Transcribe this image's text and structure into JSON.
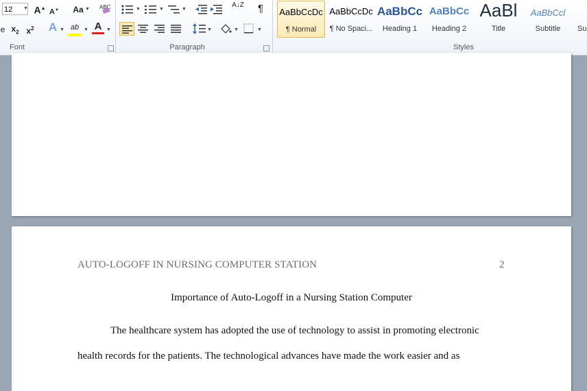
{
  "ribbon": {
    "font_size": "12",
    "groups": {
      "font": "Font",
      "paragraph": "Paragraph",
      "styles": "Styles"
    },
    "styles": [
      {
        "preview": "AaBbCcDc",
        "name": "¶ Normal"
      },
      {
        "preview": "AaBbCcDc",
        "name": "¶ No Spaci..."
      },
      {
        "preview": "AaBbCc",
        "name": "Heading 1"
      },
      {
        "preview": "AaBbCc",
        "name": "Heading 2"
      },
      {
        "preview": "AaBl",
        "name": "Title"
      },
      {
        "preview": "AaBbCcl",
        "name": "Subtitle"
      },
      {
        "preview": "",
        "name": "Su"
      }
    ],
    "buttons": {
      "grow": "A",
      "shrink": "A",
      "change_case": "Aa",
      "clear_format": "ABC",
      "subscript": "x",
      "superscript": "x",
      "text_effects": "A",
      "highlight": "ab",
      "font_color": "A",
      "sort": "A↓Z",
      "pilcrow": "¶"
    },
    "colors": {
      "highlight": "#ffff00",
      "font_color": "#e01f1f",
      "heading": "#2b579a"
    }
  },
  "document": {
    "header_text": "AUTO-LOGOFF IN NURSING COMPUTER STATION",
    "page_number": "2",
    "title": "Importance of Auto-Logoff in a Nursing Station Computer",
    "line1": "The healthcare system has adopted the use of technology to assist in promoting electronic",
    "line2": "health records for the patients. The technological advances have made the work easier and as"
  }
}
